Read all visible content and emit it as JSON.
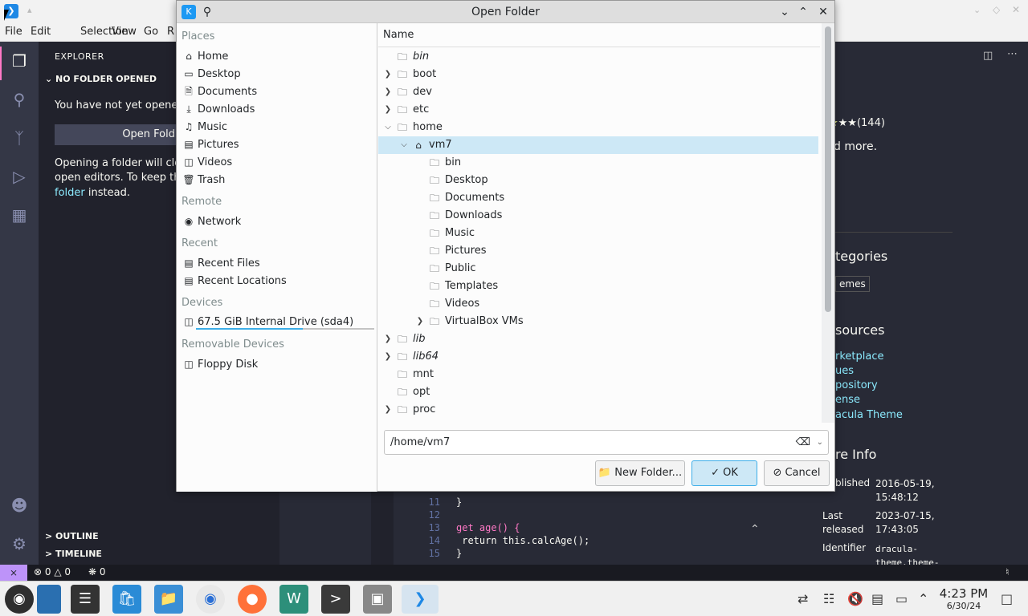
{
  "vscode": {
    "menu": [
      "File",
      "Edit",
      "Selection",
      "View",
      "Go",
      "R"
    ],
    "explorer_title": "EXPLORER",
    "no_folder": "NO FOLDER OPENED",
    "not_opened_text": "You have not yet opened",
    "open_folder_btn": "Open Fold",
    "closing_text_1": "Opening a folder will clos",
    "closing_text_2": "open editors. To keep the",
    "closing_link": "folder",
    "closing_text_3": " instead.",
    "outline": "OUTLINE",
    "timeline": "TIMELINE",
    "status": {
      "errors": "0",
      "warnings": "0",
      "ports": "0"
    }
  },
  "editor": {
    "rating": "★★(144)",
    "more": "d more.",
    "categories_heading": "tegories",
    "categories_tag": "emes",
    "resources_heading": "sources",
    "resource_links": [
      "rketplace",
      "ues",
      "pository",
      "ense",
      "acula Theme"
    ],
    "more_info_heading": "re Info",
    "published_label": "blished",
    "published_value": [
      "2016-05-19,",
      "15:48:12"
    ],
    "last_released_label": [
      "Last",
      "released"
    ],
    "last_released_value": [
      "2023-07-15,",
      "17:43:05"
    ],
    "identifier_label": "Identifier",
    "identifier_value": [
      "dracula-",
      "theme.theme-"
    ],
    "code_lines": [
      {
        "n": "11",
        "t": "}"
      },
      {
        "n": "12",
        "t": ""
      },
      {
        "n": "13",
        "t": "get age() {"
      },
      {
        "n": "14",
        "t": "  return this.calcAge();"
      },
      {
        "n": "15",
        "t": "}"
      }
    ]
  },
  "dialog": {
    "title": "Open Folder",
    "places_header": "Places",
    "places": [
      "Home",
      "Desktop",
      "Documents",
      "Downloads",
      "Music",
      "Pictures",
      "Videos",
      "Trash"
    ],
    "remote_header": "Remote",
    "remote": [
      "Network"
    ],
    "recent_header": "Recent",
    "recent": [
      "Recent Files",
      "Recent Locations"
    ],
    "devices_header": "Devices",
    "devices": [
      "67.5 GiB Internal Drive (sda4)"
    ],
    "drive_usage": 0.6,
    "removable_header": "Removable Devices",
    "removable": [
      "Floppy Disk"
    ],
    "column_name": "Name",
    "tree": [
      {
        "name": "bin",
        "italic": true,
        "expander": "",
        "depth": 0
      },
      {
        "name": "boot",
        "italic": false,
        "expander": ">",
        "depth": 0
      },
      {
        "name": "dev",
        "italic": false,
        "expander": ">",
        "depth": 0
      },
      {
        "name": "etc",
        "italic": false,
        "expander": ">",
        "depth": 0
      },
      {
        "name": "home",
        "italic": false,
        "expander": "v",
        "depth": 0
      },
      {
        "name": "vm7",
        "italic": false,
        "expander": "v",
        "depth": 1,
        "selected": true,
        "home": true
      },
      {
        "name": "bin",
        "italic": false,
        "expander": "",
        "depth": 2
      },
      {
        "name": "Desktop",
        "italic": false,
        "expander": "",
        "depth": 2
      },
      {
        "name": "Documents",
        "italic": false,
        "expander": "",
        "depth": 2
      },
      {
        "name": "Downloads",
        "italic": false,
        "expander": "",
        "depth": 2
      },
      {
        "name": "Music",
        "italic": false,
        "expander": "",
        "depth": 2
      },
      {
        "name": "Pictures",
        "italic": false,
        "expander": "",
        "depth": 2
      },
      {
        "name": "Public",
        "italic": false,
        "expander": "",
        "depth": 2
      },
      {
        "name": "Templates",
        "italic": false,
        "expander": "",
        "depth": 2
      },
      {
        "name": "Videos",
        "italic": false,
        "expander": "",
        "depth": 2
      },
      {
        "name": "VirtualBox VMs",
        "italic": false,
        "expander": ">",
        "depth": 2
      },
      {
        "name": "lib",
        "italic": true,
        "expander": ">",
        "depth": 0
      },
      {
        "name": "lib64",
        "italic": true,
        "expander": ">",
        "depth": 0
      },
      {
        "name": "mnt",
        "italic": false,
        "expander": "",
        "depth": 0
      },
      {
        "name": "opt",
        "italic": false,
        "expander": "",
        "depth": 0
      },
      {
        "name": "proc",
        "italic": false,
        "expander": ">",
        "depth": 0
      }
    ],
    "path_value": "/home/vm7",
    "new_folder_label": "New Folder...",
    "ok_label": "OK",
    "cancel_label": "Cancel"
  },
  "taskbar": {
    "time": "4:23 PM",
    "date": "6/30/24"
  }
}
